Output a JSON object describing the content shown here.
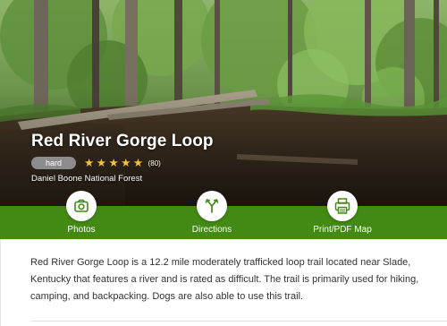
{
  "trail": {
    "name": "Red River Gorge Loop",
    "difficulty": "hard",
    "rating": 5,
    "rating_max": 5,
    "review_count": "(80)",
    "area": "Daniel Boone National Forest"
  },
  "actions": [
    {
      "label": "Photos",
      "icon": "camera-icon"
    },
    {
      "label": "Directions",
      "icon": "directions-icon"
    },
    {
      "label": "Print/PDF Map",
      "icon": "printer-icon"
    }
  ],
  "description": "Red River Gorge Loop is a 12.2 mile moderately trafficked loop trail located near Slade, Kentucky that features a river and is rated as difficult. The trail is primarily used for hiking, camping, and backpacking. Dogs are also able to use this trail.",
  "colors": {
    "action_bar": "#428a13",
    "icon": "#428a13",
    "star": "#f6c23e",
    "badge": "#8c8c8c",
    "body_text": "#333333"
  }
}
